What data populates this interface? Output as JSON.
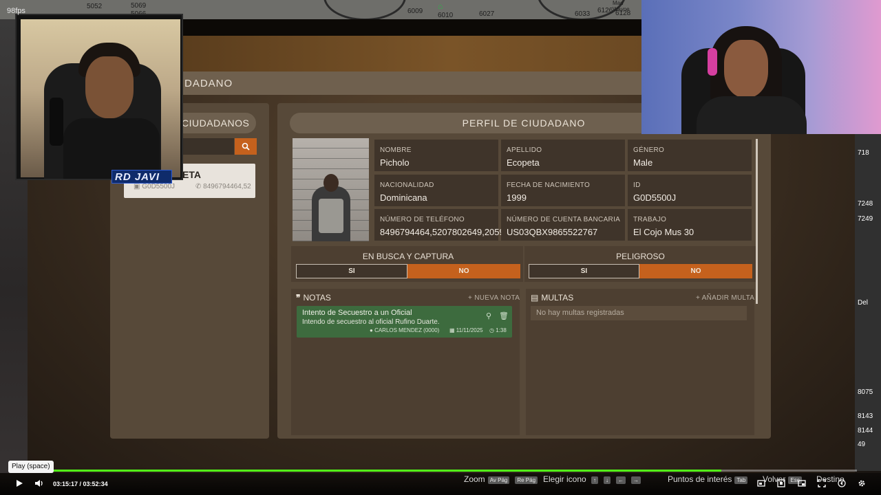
{
  "stream": {
    "fps": "98fps",
    "webcam_badge": "RD JAVI",
    "tooltip": "Play (space)",
    "time_current": "03:15:17",
    "time_total": "03:52:34",
    "progress_fraction": 0.84
  },
  "map": {
    "labels": [
      "5052",
      "5069",
      "5066",
      "6009",
      "6010",
      "6027",
      "6033",
      "6126",
      "6128",
      "Mad Wayne"
    ]
  },
  "app": {
    "section_title": "DADANO",
    "left_title": "CIUDADANOS",
    "search_placeholder": "",
    "citizen": {
      "name": "ETA",
      "id": "G0D5500J",
      "phone": "8496794464,52"
    },
    "profile_title": "PERFIL DE CIUDADANO",
    "fields": [
      {
        "label": "NOMBRE",
        "value": "Picholo"
      },
      {
        "label": "APELLIDO",
        "value": "Ecopeta"
      },
      {
        "label": "GÉNERO",
        "value": "Male"
      },
      {
        "label": "NACIONALIDAD",
        "value": "Dominicana"
      },
      {
        "label": "FECHA DE NACIMIENTO",
        "value": "1999"
      },
      {
        "label": "ID",
        "value": "G0D5500J"
      },
      {
        "label": "NÚMERO DE TELÉFONO",
        "value": "8496794464,5207802649,2059"
      },
      {
        "label": "NÚMERO DE CUENTA BANCARIA",
        "value": "US03QBX9865522767"
      },
      {
        "label": "TRABAJO",
        "value": "El Cojo Mus 30"
      }
    ],
    "wanted": {
      "title": "EN BUSCA Y CAPTURA",
      "yes": "SI",
      "no": "NO",
      "selected": "NO"
    },
    "dangerous": {
      "title": "PELIGROSO",
      "yes": "SI",
      "no": "NO",
      "selected": "NO"
    },
    "notes": {
      "title": "NOTAS",
      "action": "NUEVA NOTA",
      "items": [
        {
          "title": "Intento de Secuestro a un Oficial",
          "description": "Intendo de secuestro al oficial Rufino Duarte.",
          "author": "CARLOS MENDEZ (0000)",
          "date": "11/11/2025",
          "time": "1:38"
        }
      ]
    },
    "fines": {
      "title": "MULTAS",
      "action": "AÑADIR MULTA",
      "empty": "No hay multas registradas"
    }
  },
  "hud": {
    "zoom": "Zoom",
    "zoom_key1": "Av Pág",
    "zoom_key2": "Re Pág",
    "icon_label": "Elegir icono",
    "poi": "Puntos de interés",
    "poi_key": "Tab",
    "back": "Volver",
    "back_key": "Esc",
    "destination": "Destino"
  },
  "right_edge_labels": [
    "718",
    "7248",
    "7249",
    "Del",
    "8075",
    "8143",
    "8144",
    "49"
  ],
  "colors": {
    "accent": "#c5611d",
    "note_green": "#3d6b3e",
    "progress": "#53fc18"
  }
}
